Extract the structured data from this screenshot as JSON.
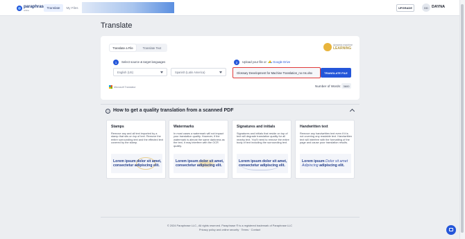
{
  "nav": {
    "brand": "paraphrase",
    "brand_sub": "online",
    "tabs": [
      "Translate",
      "My Files"
    ],
    "upgrade": "UPGRADE",
    "avatar_initials": "DD",
    "user": "DAYNA"
  },
  "page": {
    "title": "Translate"
  },
  "mode_tabs": [
    "Translate a File",
    "Translate Text"
  ],
  "partner_logo": {
    "line1": "dynamic machine",
    "line2": "LEARNING"
  },
  "steps": {
    "one": {
      "num": "1",
      "label": "Select source & target languages"
    },
    "two": {
      "num": "2",
      "label_prefix": "Upload your file or",
      "gdrive": "Google Drive"
    }
  },
  "languages": {
    "source": "English (US)",
    "target": "Spanish (Latin America)"
  },
  "file": {
    "name": "Glossary Development for Machine Translation_no ms.xlsx",
    "button": "TRANSLATE FILE"
  },
  "microsoft": "Microsoft Translator",
  "words": {
    "label": "Number of Words:",
    "value": "3600"
  },
  "howto": {
    "title": "How to get a quality translation from a scanned PDF"
  },
  "tips": [
    {
      "title": "Stamps",
      "body": "Remove any and all text imported by a stamp that sits on top of text. Remove the entire surrounding text and the effected text covered by the stamp.",
      "sample": "Lorem ipsum dolor sit amet, consectetur adipiscing elit."
    },
    {
      "title": "Watermarks",
      "body": "In most cases a watermark will not impact your translation quality. However, if the watermark is almost the same darkness as the text, it may interfere with the OCR quality.",
      "sample": "Lorem ipsum dolor sit amet, consectetur adipiscing elit."
    },
    {
      "title": "Signatures and initials",
      "body": "Signatures and initials that reside on top of text will degrade translation quality for all nearby text. You'll need to remove the entire body of text including the surrounding text.",
      "sample": "Lorem ipsum dolor sit amet, consectetur adipiscing elit."
    },
    {
      "title": "Handwritten text",
      "body": "Remove any handwritten text even if it is not covering any readable text. Handwritten text will interfere with the formatting of the page and cause poor translation results.",
      "sample_a": "Lorem ipsum",
      "sample_hand": "Dolor sit amet",
      "sample_b": "consectetur",
      "sample_hand2": "Adipiscing",
      "sample_c": "adipiscing elit."
    }
  ],
  "footer": {
    "line1": "© 2024 Paraphrase LLC., All rights reserved. Paraphrase ® is a registered trademark of Paraphrase LLC",
    "line2": "Privacy policy and online security · Terms · Contact"
  }
}
